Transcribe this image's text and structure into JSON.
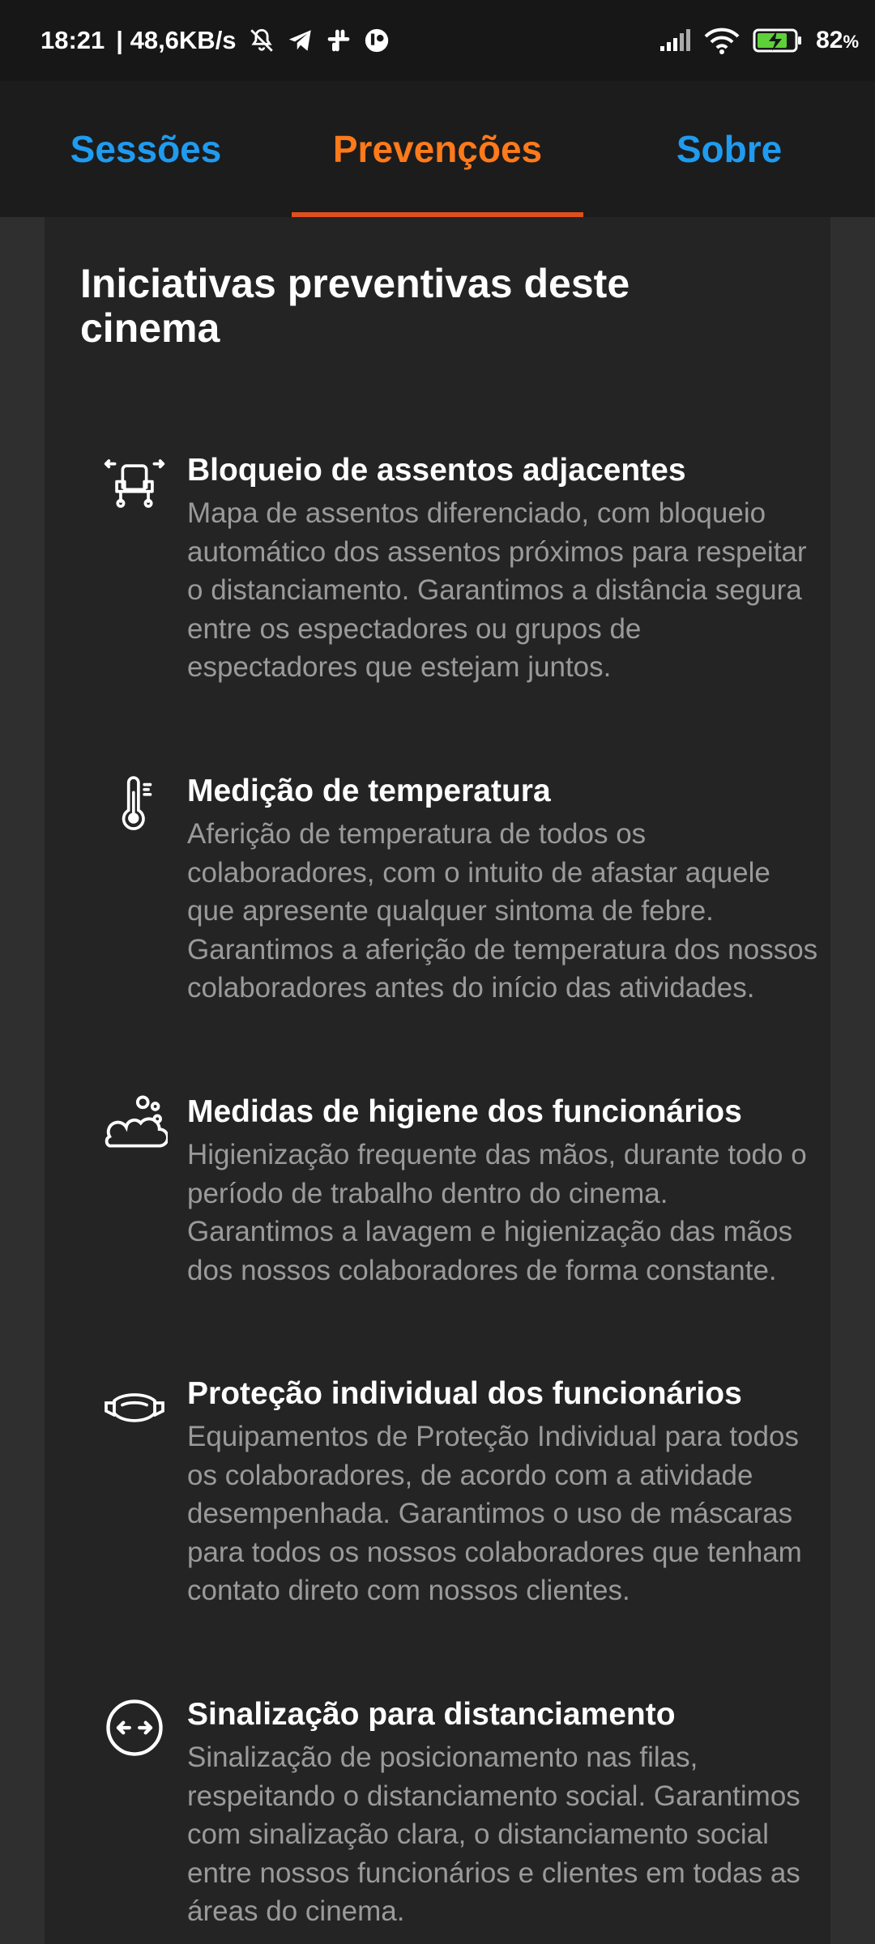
{
  "status_bar": {
    "time": "18:21",
    "network_speed": "| 48,6KB/s",
    "icons": [
      "bell-muted-icon",
      "telegram-icon",
      "slack-icon",
      "app-notification-icon",
      "signal-icon",
      "wifi-icon",
      "battery-charging-icon"
    ],
    "battery_percent": "82",
    "battery_symbol": "%"
  },
  "tabs": [
    {
      "label": "Sessões",
      "active": false
    },
    {
      "label": "Prevenções",
      "active": true
    },
    {
      "label": "Sobre",
      "active": false
    }
  ],
  "colors": {
    "tab_inactive": "#1f9bf0",
    "tab_active": "#ff7a1a",
    "tab_indicator": "#e0501c",
    "background": "#2f2f2f",
    "card": "#242424"
  },
  "main": {
    "title": "Iniciativas preventivas deste cinema",
    "items": [
      {
        "icon": "seat-block-icon",
        "title": "Bloqueio de assentos adjacentes",
        "description": "Mapa de assentos diferenciado, com bloqueio automático dos assentos próximos para respeitar o distanciamento. Garantimos a distância segura entre os espectadores ou grupos de espectadores que estejam juntos."
      },
      {
        "icon": "thermometer-icon",
        "title": "Medição de temperatura",
        "description": "Aferição de temperatura de todos os colaboradores, com o intuito de afastar aquele que apresente qualquer sintoma de febre. Garantimos a aferição de temperatura dos nossos colaboradores antes do início das atividades."
      },
      {
        "icon": "soap-bubbles-icon",
        "title": "Medidas de higiene dos funcionários",
        "description": "Higienização frequente das mãos, durante todo o período de trabalho dentro do cinema. Garantimos a lavagem e higienização das mãos dos nossos colaboradores de forma constante."
      },
      {
        "icon": "face-mask-icon",
        "title": "Proteção individual dos funcionários",
        "description": "Equipamentos de Proteção Individual para todos os colaboradores, de acordo com a atividade desempenhada. Garantimos o uso de máscaras para todos os nossos colaboradores que tenham contato direto com nossos clientes."
      },
      {
        "icon": "distance-arrows-icon",
        "title": "Sinalização para distanciamento",
        "description": "Sinalização de posicionamento nas filas, respeitando o distanciamento social. Garantimos com sinalização clara, o distanciamento social entre nossos funcionários e clientes em todas as áreas do cinema."
      }
    ]
  }
}
